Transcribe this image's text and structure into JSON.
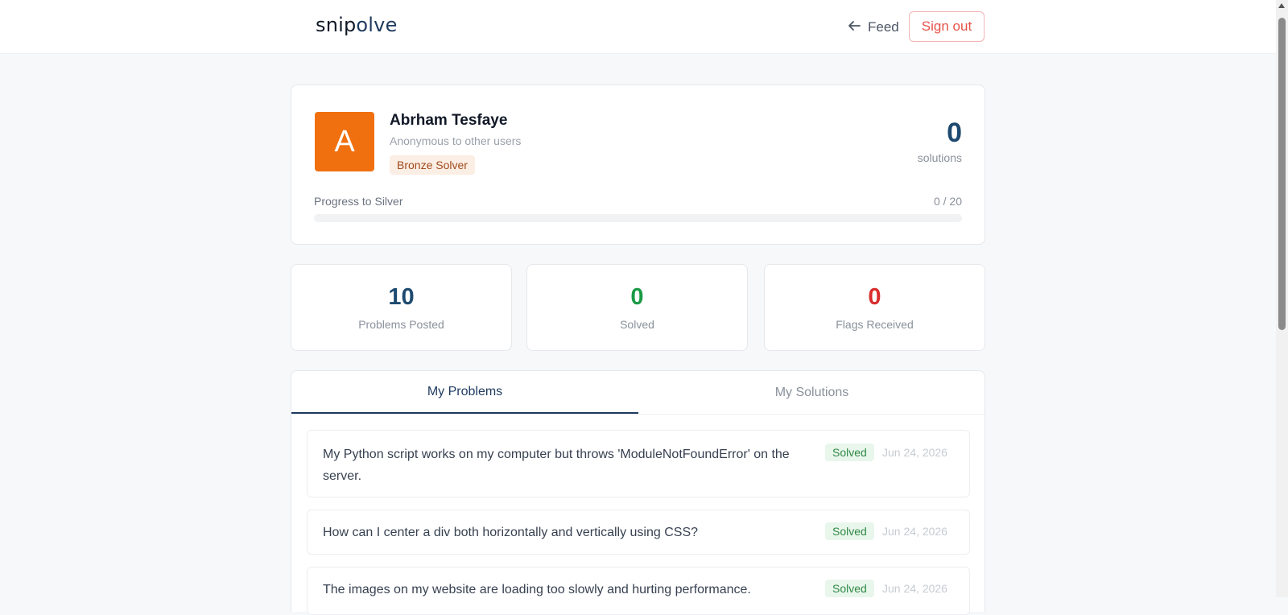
{
  "header": {
    "logo_part1": "snip",
    "logo_part2": "olve",
    "feed_label": "Feed",
    "signout_label": "Sign out"
  },
  "profile": {
    "avatar_letter": "A",
    "name": "Abrham Tesfaye",
    "subtitle": "Anonymous to other users",
    "badge": "Bronze Solver",
    "solutions_count": "0",
    "solutions_label": "solutions",
    "progress_label": "Progress to Silver",
    "progress_value": "0 / 20",
    "progress_fraction": 0
  },
  "stats": [
    {
      "value": "10",
      "label": "Problems Posted",
      "color": "#1e4a70"
    },
    {
      "value": "0",
      "label": "Solved",
      "color": "#1a9a45"
    },
    {
      "value": "0",
      "label": "Flags Received",
      "color": "#d92d2d"
    }
  ],
  "tabs": [
    {
      "label": "My Problems",
      "active": true
    },
    {
      "label": "My Solutions",
      "active": false
    }
  ],
  "problems": [
    {
      "title": "My Python script works on my computer but throws 'ModuleNotFoundError' on the server.",
      "status": "Solved",
      "date": "Jun 24, 2026"
    },
    {
      "title": "How can I center a div both horizontally and vertically using CSS?",
      "status": "Solved",
      "date": "Jun 24, 2026"
    },
    {
      "title": "The images on my website are loading too slowly and hurting performance.",
      "status": "Solved",
      "date": "Jun 24, 2026"
    }
  ],
  "colors": {
    "brand_dark": "#1e3a5f",
    "avatar_bg": "#f07010",
    "danger": "#e5534b",
    "success": "#2f8a45"
  }
}
